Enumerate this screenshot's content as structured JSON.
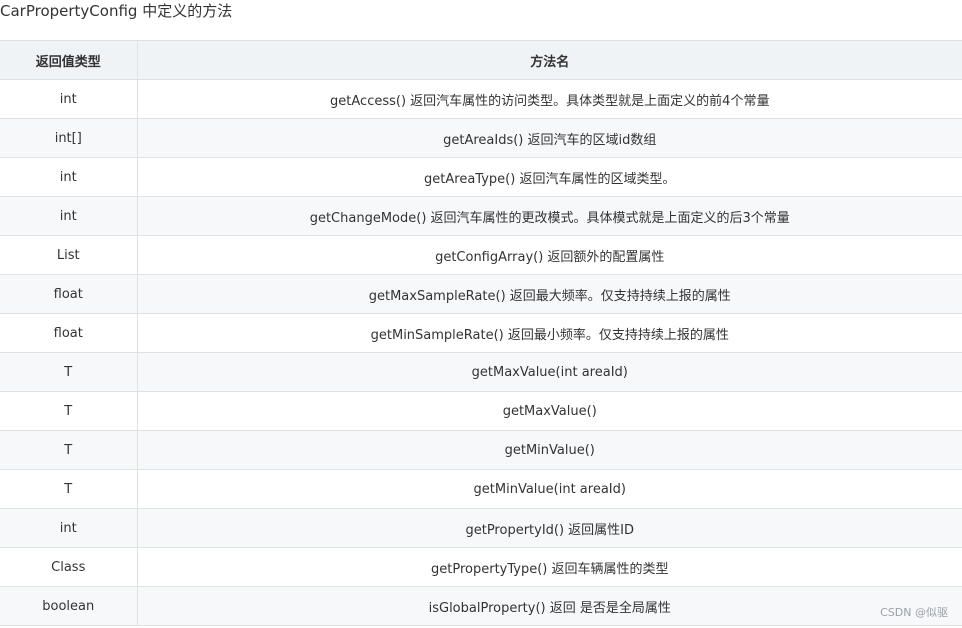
{
  "title": "CarPropertyConfig 中定义的方法",
  "table": {
    "headers": [
      "返回值类型",
      "方法名"
    ],
    "rows": [
      {
        "type": "int",
        "method": "getAccess() 返回汽车属性的访问类型。具体类型就是上面定义的前4个常量"
      },
      {
        "type": "int[]",
        "method": "getAreaIds() 返回汽车的区域id数组"
      },
      {
        "type": "int",
        "method": "getAreaType() 返回汽车属性的区域类型。"
      },
      {
        "type": "int",
        "method": "getChangeMode() 返回汽车属性的更改模式。具体模式就是上面定义的后3个常量"
      },
      {
        "type": "List",
        "method": "getConfigArray() 返回额外的配置属性"
      },
      {
        "type": "float",
        "method": "getMaxSampleRate() 返回最大频率。仅支持持续上报的属性"
      },
      {
        "type": "float",
        "method": "getMinSampleRate() 返回最小频率。仅支持持续上报的属性"
      },
      {
        "type": "T",
        "method": "getMaxValue(int areaId)"
      },
      {
        "type": "T",
        "method": "getMaxValue()"
      },
      {
        "type": "T",
        "method": "getMinValue()"
      },
      {
        "type": "T",
        "method": "getMinValue(int areaId)"
      },
      {
        "type": "int",
        "method": "getPropertyId() 返回属性ID"
      },
      {
        "type": "Class",
        "method": "getPropertyType() 返回车辆属性的类型"
      },
      {
        "type": "boolean",
        "method": "isGlobalProperty() 返回 是否是全局属性"
      }
    ]
  },
  "watermark": "CSDN @似驱"
}
